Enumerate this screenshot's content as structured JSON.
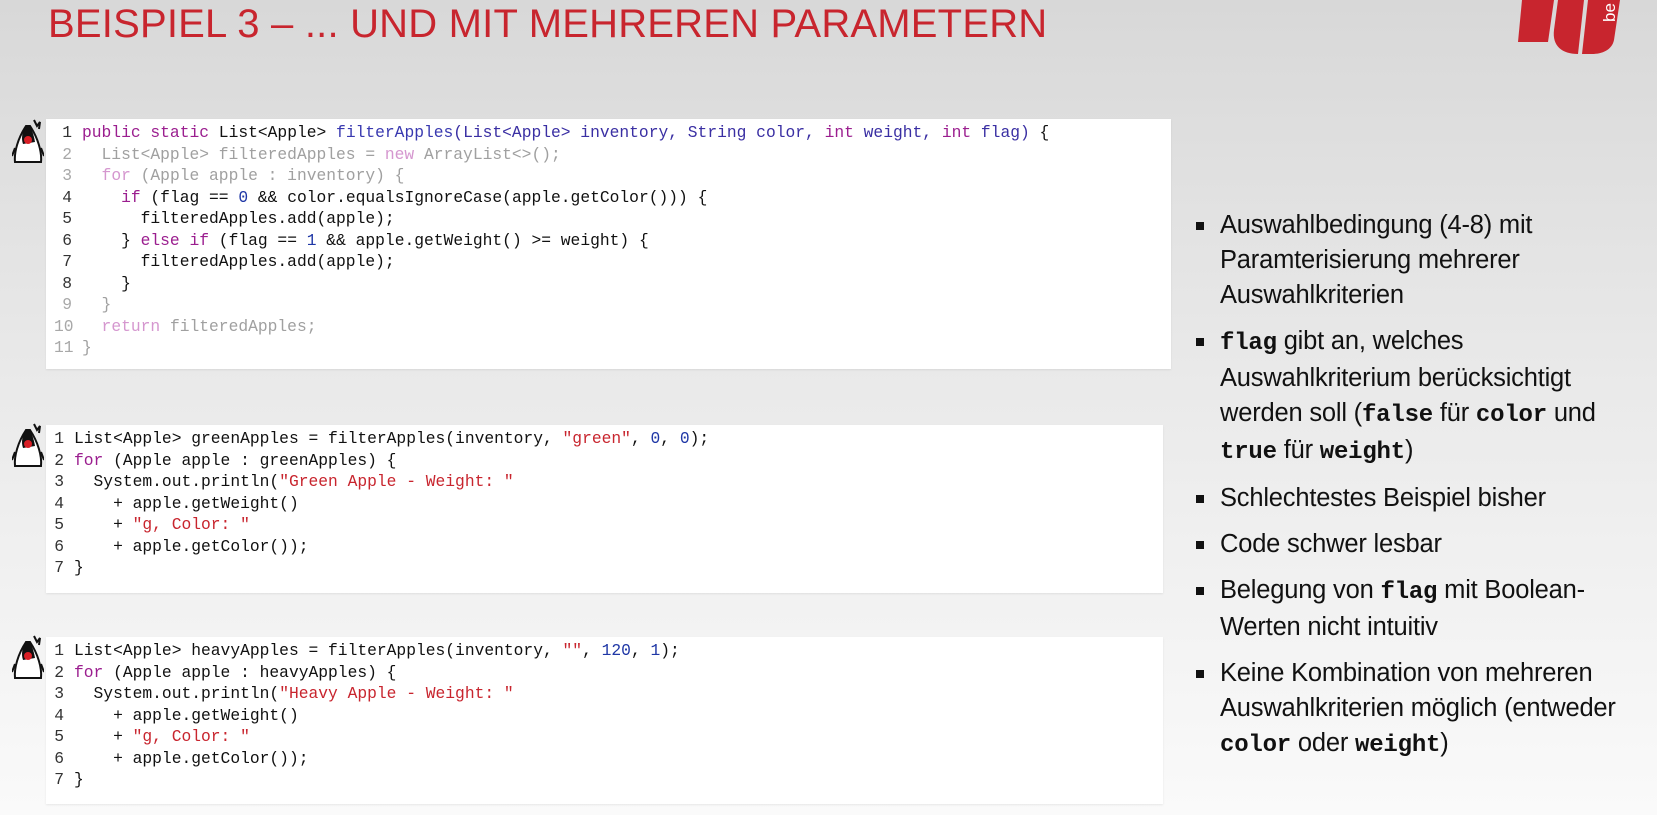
{
  "slide": {
    "title": "BEISPIEL 3 – ... UND MIT MEHREREN PARAMETERN",
    "logo_text": "be",
    "brand_color": "#c8252e"
  },
  "code_blocks": [
    {
      "lines": [
        {
          "n": "1",
          "dim": false,
          "tokens": [
            {
              "t": "public static ",
              "c": "kw"
            },
            {
              "t": "List<Apple> ",
              "c": ""
            },
            {
              "t": "filterApples",
              "c": "fn"
            },
            {
              "t": "(List<Apple> inventory, String color, ",
              "c": "par"
            },
            {
              "t": "int",
              "c": "kw"
            },
            {
              "t": " weight, ",
              "c": "par"
            },
            {
              "t": "int",
              "c": "kw"
            },
            {
              "t": " flag) ",
              "c": "par"
            },
            {
              "t": "{",
              "c": ""
            }
          ]
        },
        {
          "n": "2",
          "dim": true,
          "tokens": [
            {
              "t": "  List<Apple> filteredApples = ",
              "c": ""
            },
            {
              "t": "new",
              "c": "kw"
            },
            {
              "t": " ArrayList<>();",
              "c": ""
            }
          ]
        },
        {
          "n": "3",
          "dim": true,
          "tokens": [
            {
              "t": "  ",
              "c": ""
            },
            {
              "t": "for",
              "c": "kw"
            },
            {
              "t": " (Apple apple : inventory) {",
              "c": ""
            }
          ]
        },
        {
          "n": "4",
          "dim": false,
          "tokens": [
            {
              "t": "    ",
              "c": ""
            },
            {
              "t": "if",
              "c": "kw"
            },
            {
              "t": " (flag == ",
              "c": ""
            },
            {
              "t": "0",
              "c": "num"
            },
            {
              "t": " && color.equalsIgnoreCase(apple.getColor())) {",
              "c": ""
            }
          ]
        },
        {
          "n": "5",
          "dim": false,
          "tokens": [
            {
              "t": "      filteredApples.add(apple);",
              "c": ""
            }
          ]
        },
        {
          "n": "6",
          "dim": false,
          "tokens": [
            {
              "t": "    } ",
              "c": ""
            },
            {
              "t": "else if",
              "c": "kw"
            },
            {
              "t": " (flag == ",
              "c": ""
            },
            {
              "t": "1",
              "c": "num"
            },
            {
              "t": " && apple.getWeight() >= weight) {",
              "c": ""
            }
          ]
        },
        {
          "n": "7",
          "dim": false,
          "tokens": [
            {
              "t": "      filteredApples.add(apple);",
              "c": ""
            }
          ]
        },
        {
          "n": "8",
          "dim": false,
          "tokens": [
            {
              "t": "    }",
              "c": ""
            }
          ]
        },
        {
          "n": "9",
          "dim": true,
          "tokens": [
            {
              "t": "  }",
              "c": ""
            }
          ]
        },
        {
          "n": "10",
          "dim": true,
          "tokens": [
            {
              "t": "  ",
              "c": ""
            },
            {
              "t": "return",
              "c": "kw"
            },
            {
              "t": " filteredApples;",
              "c": ""
            }
          ]
        },
        {
          "n": "11",
          "dim": true,
          "tokens": [
            {
              "t": "}",
              "c": ""
            }
          ]
        }
      ]
    },
    {
      "lines": [
        {
          "n": "1",
          "dim": false,
          "tokens": [
            {
              "t": "List<Apple> greenApples = filterApples(inventory, ",
              "c": ""
            },
            {
              "t": "\"green\"",
              "c": "str"
            },
            {
              "t": ", ",
              "c": ""
            },
            {
              "t": "0",
              "c": "num"
            },
            {
              "t": ", ",
              "c": ""
            },
            {
              "t": "0",
              "c": "num"
            },
            {
              "t": ");",
              "c": ""
            }
          ]
        },
        {
          "n": "2",
          "dim": false,
          "tokens": [
            {
              "t": "for",
              "c": "kw"
            },
            {
              "t": " (Apple apple : greenApples) {",
              "c": ""
            }
          ]
        },
        {
          "n": "3",
          "dim": false,
          "tokens": [
            {
              "t": "  System.out.println(",
              "c": ""
            },
            {
              "t": "\"Green Apple - Weight: \"",
              "c": "str"
            }
          ]
        },
        {
          "n": "4",
          "dim": false,
          "tokens": [
            {
              "t": "    + apple.getWeight()",
              "c": ""
            }
          ]
        },
        {
          "n": "5",
          "dim": false,
          "tokens": [
            {
              "t": "    + ",
              "c": ""
            },
            {
              "t": "\"g, Color: \"",
              "c": "str"
            }
          ]
        },
        {
          "n": "6",
          "dim": false,
          "tokens": [
            {
              "t": "    + apple.getColor());",
              "c": ""
            }
          ]
        },
        {
          "n": "7",
          "dim": false,
          "tokens": [
            {
              "t": "}",
              "c": ""
            }
          ]
        }
      ]
    },
    {
      "lines": [
        {
          "n": "1",
          "dim": false,
          "tokens": [
            {
              "t": "List<Apple> heavyApples = filterApples(inventory, ",
              "c": ""
            },
            {
              "t": "\"\"",
              "c": "str"
            },
            {
              "t": ", ",
              "c": ""
            },
            {
              "t": "120",
              "c": "num"
            },
            {
              "t": ", ",
              "c": ""
            },
            {
              "t": "1",
              "c": "num"
            },
            {
              "t": ");",
              "c": ""
            }
          ]
        },
        {
          "n": "2",
          "dim": false,
          "tokens": [
            {
              "t": "for",
              "c": "kw"
            },
            {
              "t": " (Apple apple : heavyApples) {",
              "c": ""
            }
          ]
        },
        {
          "n": "3",
          "dim": false,
          "tokens": [
            {
              "t": "  System.out.println(",
              "c": ""
            },
            {
              "t": "\"Heavy Apple - Weight: \"",
              "c": "str"
            }
          ]
        },
        {
          "n": "4",
          "dim": false,
          "tokens": [
            {
              "t": "    + apple.getWeight()",
              "c": ""
            }
          ]
        },
        {
          "n": "5",
          "dim": false,
          "tokens": [
            {
              "t": "    + ",
              "c": ""
            },
            {
              "t": "\"g, Color: \"",
              "c": "str"
            }
          ]
        },
        {
          "n": "6",
          "dim": false,
          "tokens": [
            {
              "t": "    + apple.getColor());",
              "c": ""
            }
          ]
        },
        {
          "n": "7",
          "dim": false,
          "tokens": [
            {
              "t": "}",
              "c": ""
            }
          ]
        }
      ]
    }
  ],
  "bullets": [
    [
      {
        "t": "Auswahlbedingung (4-8) mit Paramterisierung mehrerer Auswahlkriterien",
        "m": false
      }
    ],
    [
      {
        "t": "flag",
        "m": true
      },
      {
        "t": " gibt an, welches Auswahlkriterium berücksichtigt werden soll (",
        "m": false
      },
      {
        "t": "false",
        "m": true
      },
      {
        "t": " für ",
        "m": false
      },
      {
        "t": "color",
        "m": true
      },
      {
        "t": " und ",
        "m": false
      },
      {
        "t": "true",
        "m": true
      },
      {
        "t": " für ",
        "m": false
      },
      {
        "t": "weight",
        "m": true
      },
      {
        "t": ")",
        "m": false
      }
    ],
    [
      {
        "t": "Schlechtestes Beispiel bisher",
        "m": false
      }
    ],
    [
      {
        "t": "Code schwer lesbar",
        "m": false
      }
    ],
    [
      {
        "t": "Belegung von ",
        "m": false
      },
      {
        "t": "flag",
        "m": true
      },
      {
        "t": " mit Boolean-Werten nicht intuitiv",
        "m": false
      }
    ],
    [
      {
        "t": "Keine Kombination von mehreren Auswahlkriterien möglich (entweder ",
        "m": false
      },
      {
        "t": "color",
        "m": true
      },
      {
        "t": " oder ",
        "m": false
      },
      {
        "t": "weight",
        "m": true
      },
      {
        "t": ")",
        "m": false
      }
    ]
  ]
}
